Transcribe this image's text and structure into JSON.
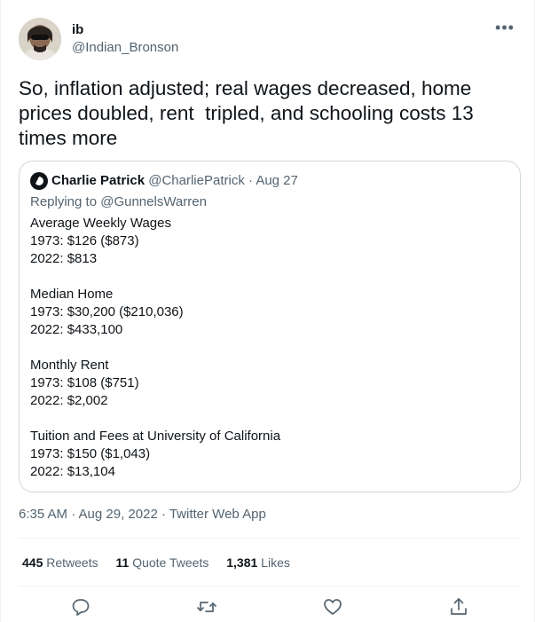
{
  "author": {
    "display_name": "ib",
    "handle": "@Indian_Bronson",
    "avatar_icon": "avatar-photo-icon"
  },
  "tweet": {
    "text": "So, inflation adjusted; real wages decreased, home prices doubled, rent  tripled, and schooling costs 13 times more",
    "timestamp": "6:35 AM · Aug 29, 2022 · Twitter Web App"
  },
  "quoted_tweet": {
    "display_name": "Charlie Patrick",
    "handle_date": "@CharliePatrick · Aug 27",
    "replying_prefix": "Replying to",
    "replying_to": "@GunnelsWarren",
    "text": "Average Weekly Wages\n1973: $126 ($873)\n2022: $813\n\nMedian Home\n1973: $30,200 ($210,036)\n2022: $433,100\n\nMonthly Rent\n1973: $108 ($751)\n2022: $2,002\n\nTuition and Fees at University of California\n1973: $150 ($1,043)\n2022: $13,104"
  },
  "stats": {
    "retweets_count": "445",
    "retweets_label": "Retweets",
    "quote_tweets_count": "11",
    "quote_tweets_label": "Quote Tweets",
    "likes_count": "1,381",
    "likes_label": "Likes"
  },
  "actions": [
    "reply-icon",
    "retweet-icon",
    "like-icon",
    "share-icon"
  ],
  "colors": {
    "text_primary": "#0f1419",
    "text_secondary": "#536471",
    "border": "#cfd9de",
    "divider": "#eff3f4"
  }
}
